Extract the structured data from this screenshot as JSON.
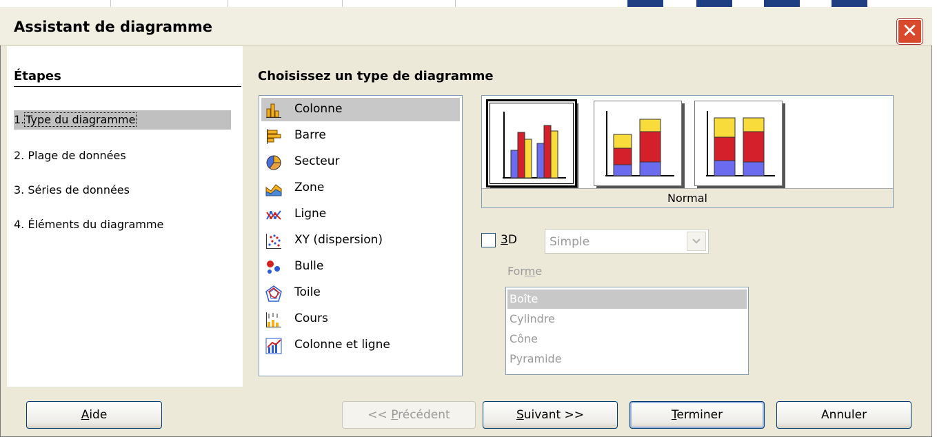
{
  "dialog": {
    "title": "Assistant de diagramme",
    "close_glyph": "✕"
  },
  "steps": {
    "heading": "Étapes",
    "items": [
      {
        "num": "1.",
        "label": "Type du diagramme"
      },
      {
        "num": "2.",
        "label": "Plage de données"
      },
      {
        "num": "3.",
        "label": "Séries de données"
      },
      {
        "num": "4.",
        "label": "Éléments du diagramme"
      }
    ],
    "active_index": 0
  },
  "main": {
    "heading": "Choisissez un type de diagramme",
    "chart_types": [
      {
        "label": "Colonne",
        "icon": "column-chart-icon"
      },
      {
        "label": "Barre",
        "icon": "bar-chart-icon"
      },
      {
        "label": "Secteur",
        "icon": "pie-chart-icon"
      },
      {
        "label": "Zone",
        "icon": "area-chart-icon"
      },
      {
        "label": "Ligne",
        "icon": "line-chart-icon"
      },
      {
        "label": "XY (dispersion)",
        "icon": "scatter-chart-icon"
      },
      {
        "label": "Bulle",
        "icon": "bubble-chart-icon"
      },
      {
        "label": "Toile",
        "icon": "radar-chart-icon"
      },
      {
        "label": "Cours",
        "icon": "stock-chart-icon"
      },
      {
        "label": "Colonne et ligne",
        "icon": "column-line-chart-icon"
      }
    ],
    "selected_type_index": 0,
    "variant_caption": "Normal",
    "variants": [
      "normal-column-variant",
      "stacked-column-variant",
      "percent-stacked-column-variant"
    ],
    "selected_variant_index": 0,
    "three_d": {
      "label_prefix": "",
      "label_underlined": "3",
      "label_suffix": "D",
      "checked": false
    },
    "three_d_style": {
      "value": "Simple",
      "enabled": false
    },
    "shape": {
      "label_prefix": "For",
      "label_underlined": "m",
      "label_suffix": "e",
      "options": [
        "Boîte",
        "Cylindre",
        "Cône",
        "Pyramide"
      ],
      "selected_index": 0,
      "enabled": false
    }
  },
  "buttons": {
    "help": {
      "u": "A",
      "rest": "ide"
    },
    "previous": {
      "pre": "<< ",
      "u": "P",
      "rest": "récédent",
      "enabled": false
    },
    "next": {
      "u": "S",
      "rest": "uivant >>",
      "enabled": true
    },
    "finish": {
      "u": "T",
      "rest": "erminer",
      "enabled": true
    },
    "cancel": {
      "label": "Annuler",
      "enabled": true
    }
  },
  "colors": {
    "blue": "#6b6bf0",
    "red": "#d4202a",
    "yellow": "#f8dc3c",
    "dialog_bg": "#ece9d8",
    "close_red": "#d94a2c"
  }
}
